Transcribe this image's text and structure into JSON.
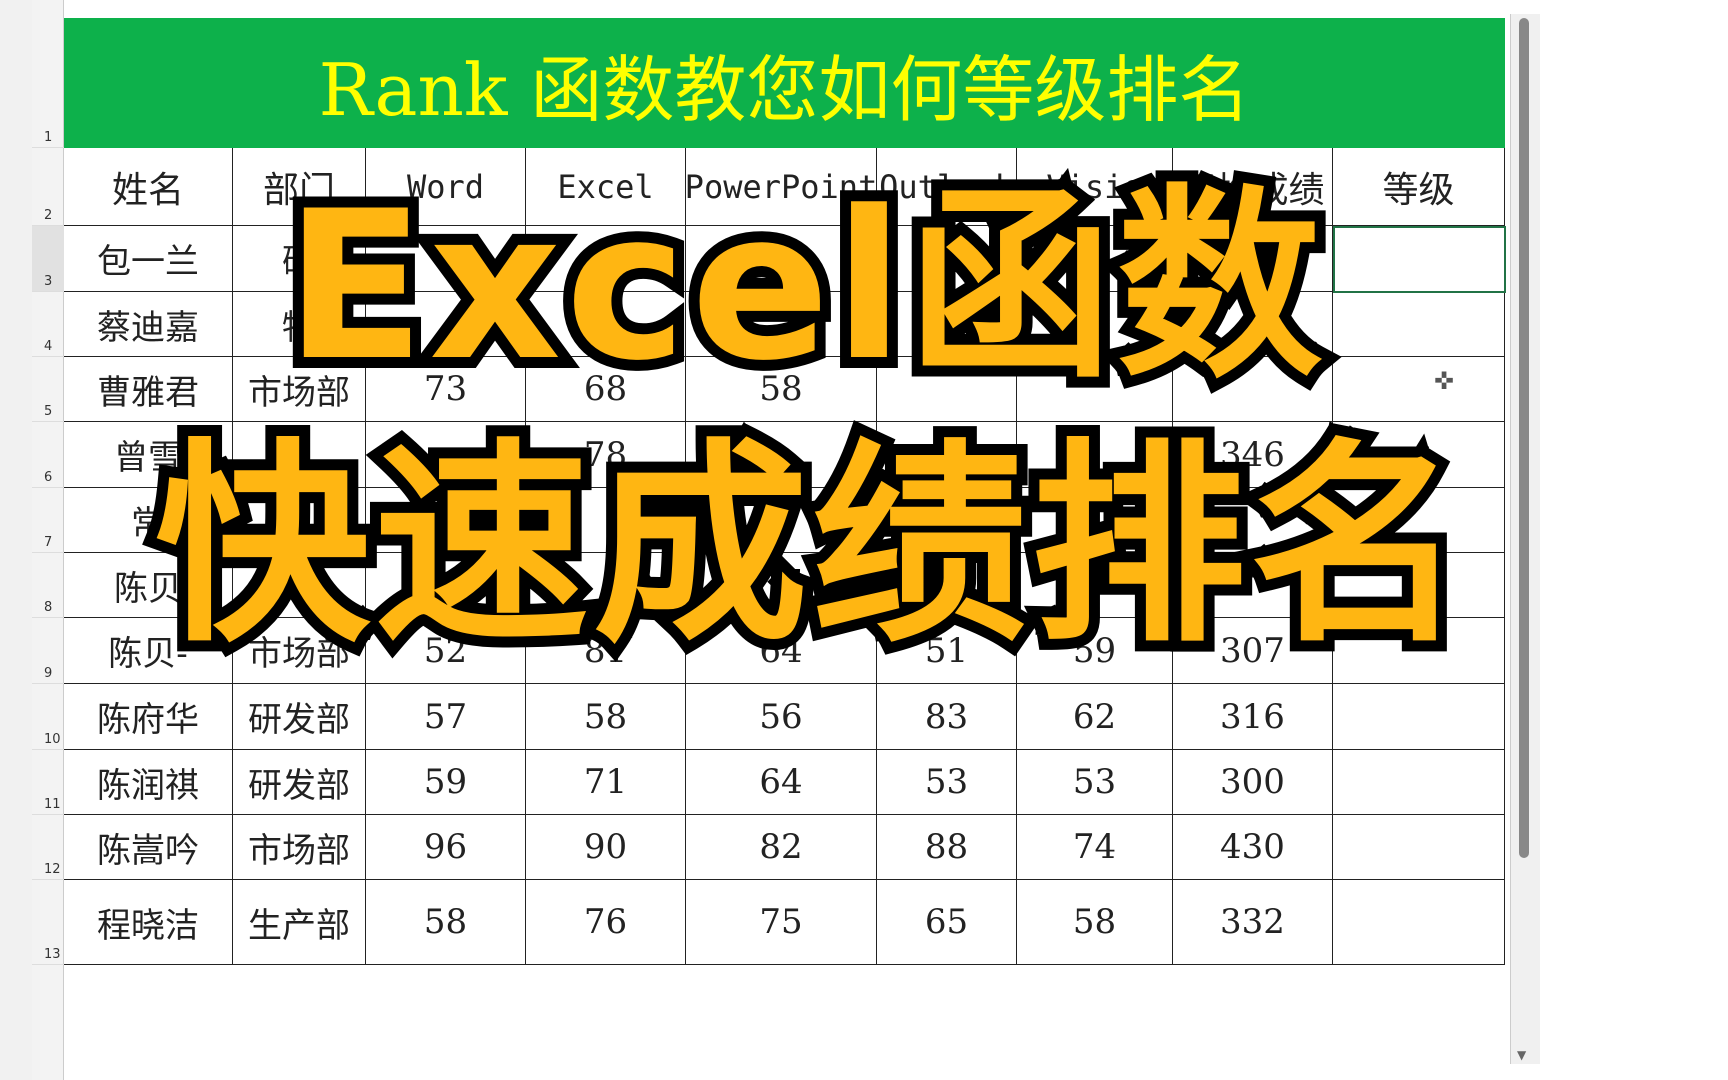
{
  "title": "Rank 函数教您如何等级排名",
  "row_numbers": [
    "1",
    "2",
    "3",
    "4",
    "5",
    "6",
    "7",
    "8",
    "9",
    "10",
    "11",
    "12",
    "13"
  ],
  "headers": [
    "姓名",
    "部门",
    "Word",
    "Excel",
    "PowerPoint",
    "Outlook",
    "Visio",
    "平均成绩",
    "等级"
  ],
  "rows": [
    [
      "包一兰",
      "研",
      "",
      "",
      "",
      "",
      "",
      "",
      ""
    ],
    [
      "蔡迪嘉",
      "物",
      "",
      "",
      "",
      "",
      "",
      "",
      ""
    ],
    [
      "曹雅君",
      "市场部",
      "73",
      "68",
      "58",
      "",
      "",
      "",
      ""
    ],
    [
      "曾雪",
      "",
      "",
      "78",
      "",
      "",
      "",
      "346",
      ""
    ],
    [
      "常",
      "",
      "",
      "",
      "",
      "",
      "",
      "",
      ""
    ],
    [
      "陈贝",
      "",
      "",
      "",
      "",
      "",
      "",
      "",
      ""
    ],
    [
      "陈贝-",
      "市场部",
      "52",
      "81",
      "64",
      "51",
      "59",
      "307",
      ""
    ],
    [
      "陈府华",
      "研发部",
      "57",
      "58",
      "56",
      "83",
      "62",
      "316",
      ""
    ],
    [
      "陈润祺",
      "研发部",
      "59",
      "71",
      "64",
      "53",
      "53",
      "300",
      ""
    ],
    [
      "陈嵩吟",
      "市场部",
      "96",
      "90",
      "82",
      "88",
      "74",
      "430",
      ""
    ],
    [
      "程晓洁",
      "生产部",
      "58",
      "76",
      "75",
      "65",
      "58",
      "332",
      ""
    ]
  ],
  "overlay": {
    "line1": "Excel函数",
    "line2": "快速成绩排名",
    "fill_color": "#FFB612",
    "stroke_color": "#000000"
  },
  "colors": {
    "title_bg": "#0DB14B",
    "title_text": "#FFFF00"
  }
}
